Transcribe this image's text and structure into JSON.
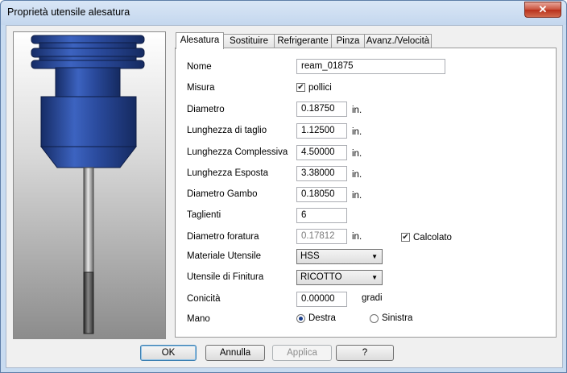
{
  "window": {
    "title": "Proprietà utensile alesatura",
    "close_label": "✕"
  },
  "tabs": [
    {
      "label": "Alesatura",
      "active": true
    },
    {
      "label": "Sostituire",
      "active": false
    },
    {
      "label": "Refrigerante",
      "active": false
    },
    {
      "label": "Pinza",
      "active": false
    },
    {
      "label": "Avanz./Velocità",
      "active": false
    }
  ],
  "form": {
    "nome": {
      "label": "Nome",
      "value": "ream_01875"
    },
    "misura": {
      "label": "Misura",
      "checkbox_label": "pollici",
      "checked": true
    },
    "diametro": {
      "label": "Diametro",
      "value": "0.18750",
      "unit": "in."
    },
    "lunghezza_taglio": {
      "label": "Lunghezza di taglio",
      "value": "1.12500",
      "unit": "in."
    },
    "lunghezza_complessiva": {
      "label": "Lunghezza Complessiva",
      "value": "4.50000",
      "unit": "in."
    },
    "lunghezza_esposta": {
      "label": "Lunghezza Esposta",
      "value": "3.38000",
      "unit": "in."
    },
    "diametro_gambo": {
      "label": "Diametro Gambo",
      "value": "0.18050",
      "unit": "in."
    },
    "taglienti": {
      "label": "Taglienti",
      "value": "6"
    },
    "diametro_foratura": {
      "label": "Diametro foratura",
      "value": "0.17812",
      "unit": "in.",
      "checkbox_label": "Calcolato",
      "checked": true
    },
    "materiale": {
      "label": "Materiale Utensile",
      "value": "HSS"
    },
    "finitura": {
      "label": "Utensile di Finitura",
      "value": "RICOTTO"
    },
    "conicita": {
      "label": "Conicità",
      "value": "0.00000",
      "unit": "gradi"
    },
    "mano": {
      "label": "Mano",
      "option_right": "Destra",
      "option_left": "Sinistra",
      "selected": "Destra"
    }
  },
  "buttons": {
    "ok": "OK",
    "cancel": "Annulla",
    "apply": "Applica",
    "help": "?"
  },
  "colors": {
    "holder_blue": "#2a4a9c",
    "title_bar": "#c4d7ee"
  }
}
